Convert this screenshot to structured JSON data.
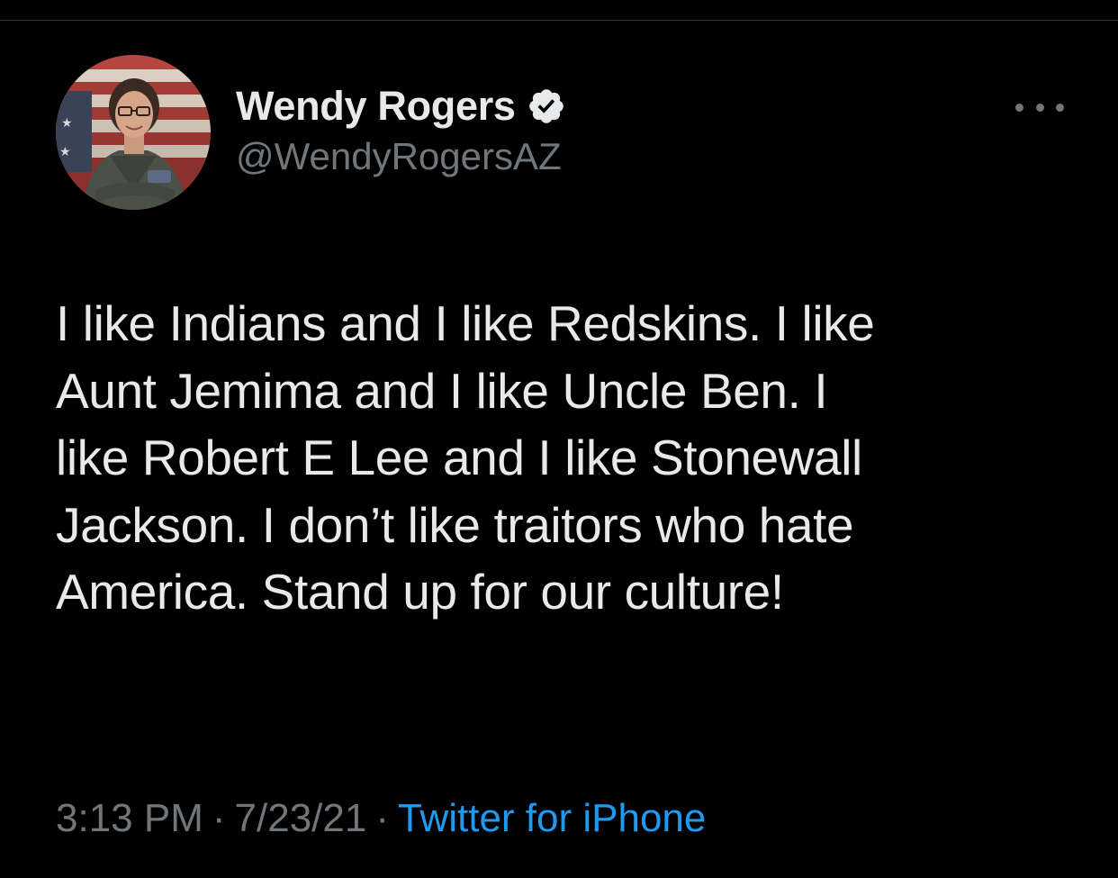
{
  "tweet": {
    "author": {
      "display_name": "Wendy Rogers",
      "handle": "@WendyRogersAZ",
      "verified": true,
      "avatar_icon": "profile-photo-icon"
    },
    "more_icon": "more-options-icon",
    "text_lines": [
      "I like Indians and I like Redskins. I like",
      "Aunt Jemima and I like Uncle Ben. I",
      "like Robert E Lee and I like Stonewall",
      "Jackson. I don’t like traitors who hate",
      "America. Stand up for our culture!"
    ],
    "time": "3:13 PM",
    "separator": "·",
    "date": "7/23/21",
    "source": "Twitter for iPhone"
  },
  "colors": {
    "background": "#000000",
    "primary_text": "#e7e9ea",
    "secondary_text": "#71767b",
    "link": "#1d9bf0",
    "verified_badge": "#e7e9ea"
  }
}
